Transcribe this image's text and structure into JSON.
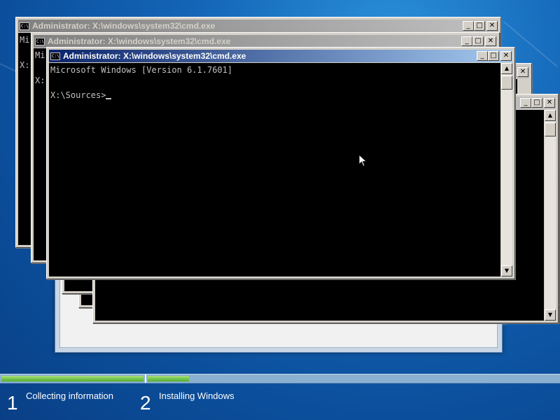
{
  "windows": [
    {
      "id": "cmd-1",
      "title": "Administrator: X:\\windows\\system32\\cmd.exe",
      "lines": [
        "Mi",
        "",
        "X:"
      ],
      "active": false
    },
    {
      "id": "cmd-2",
      "title": "Administrator: X:\\windows\\system32\\cmd.exe",
      "lines": [
        "Mi",
        "",
        "X:"
      ],
      "active": false
    },
    {
      "id": "cmd-front",
      "title": "Administrator: X:\\windows\\system32\\cmd.exe",
      "lines": [
        "Microsoft Windows [Version 6.1.7601]",
        "",
        "X:\\Sources>"
      ],
      "active": true
    }
  ],
  "window_buttons": {
    "minimize": "_",
    "maximize": "□",
    "close": "✕"
  },
  "system_icon_text": "C:\\",
  "progress": {
    "step1_fraction": 1.0,
    "step2_fraction": 0.1
  },
  "steps": [
    {
      "number": "1",
      "label": "Collecting information"
    },
    {
      "number": "2",
      "label": "Installing Windows"
    }
  ],
  "colors": {
    "active_title": "#0a246a",
    "inactive_title": "#808080",
    "console_bg": "#000000",
    "console_text": "#c0c0c0",
    "progress_green": "#4fae2c"
  }
}
